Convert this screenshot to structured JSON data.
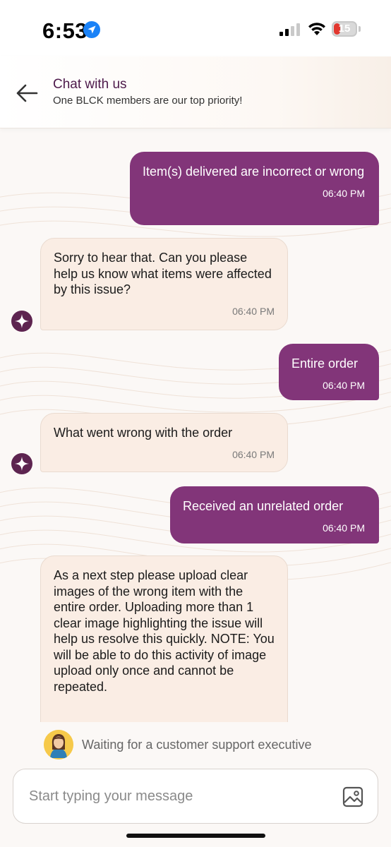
{
  "status_bar": {
    "time": "6:53",
    "battery": "15",
    "icons": [
      "location-arrow-icon",
      "signal-icon",
      "wifi-icon",
      "battery-icon"
    ]
  },
  "header": {
    "title": "Chat with us",
    "subtitle": "One BLCK members are our top priority!",
    "back_icon": "back-arrow-icon"
  },
  "colors": {
    "user_bubble": "#823579",
    "bot_bubble": "#faede4",
    "header_title": "#4d1a4b",
    "bot_avatar": "#5d2450"
  },
  "messages": [
    {
      "sender": "user",
      "text": "Item(s) delivered are incorrect or wrong",
      "time": "06:40 PM"
    },
    {
      "sender": "bot",
      "text": "Sorry to hear that. Can you please help us know what items were affected by this issue?",
      "time": "06:40 PM"
    },
    {
      "sender": "user",
      "text": "Entire order",
      "time": "06:40 PM"
    },
    {
      "sender": "bot",
      "text": "What went wrong with the order",
      "time": "06:40 PM"
    },
    {
      "sender": "user",
      "text": "Received an unrelated order",
      "time": "06:40 PM"
    },
    {
      "sender": "bot",
      "text": "As a next step please upload clear images of the wrong item with the entire order. Uploading more than 1 clear image highlighting the issue will help us resolve this quickly. NOTE: You will be able to do this activity of image upload only once and cannot be repeated.",
      "time": ""
    }
  ],
  "waiting": {
    "text": "Waiting for a customer support executive"
  },
  "composer": {
    "placeholder": "Start typing your message",
    "value": "",
    "attach_icon": "image-icon"
  }
}
